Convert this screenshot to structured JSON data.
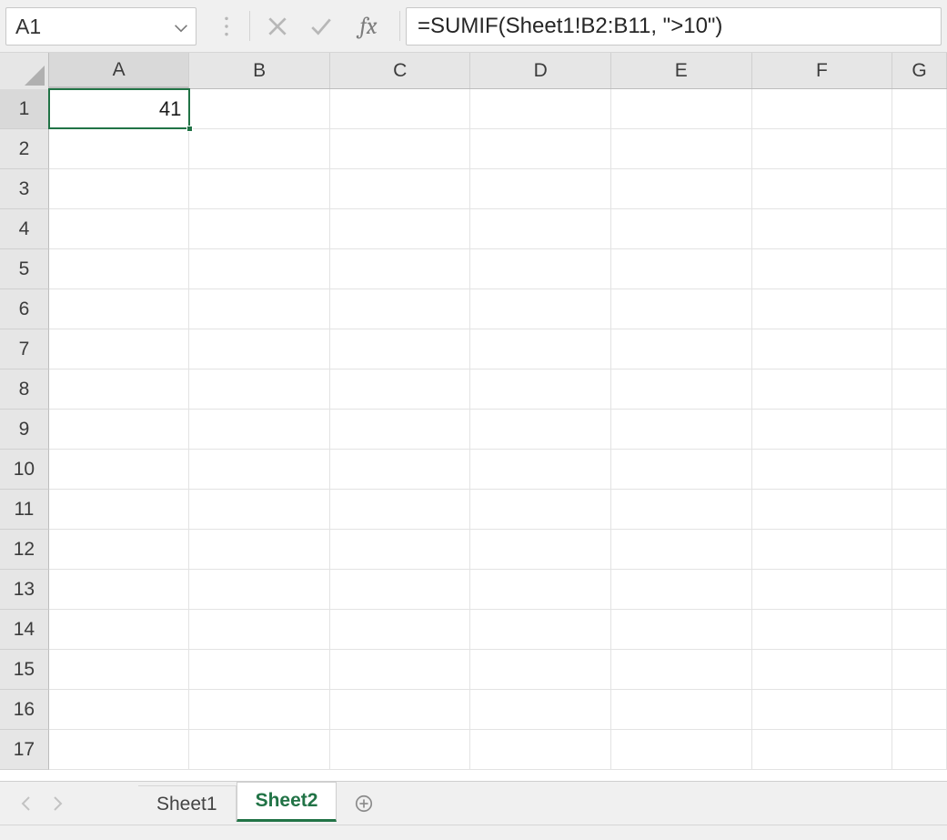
{
  "formula_bar": {
    "name_box_value": "A1",
    "formula": "=SUMIF(Sheet1!B2:B11, \">10\")"
  },
  "grid": {
    "columns": [
      "A",
      "B",
      "C",
      "D",
      "E",
      "F"
    ],
    "partial_column": "G",
    "row_count": 17,
    "selected_cell": {
      "row": 1,
      "col": "A",
      "value": "41"
    },
    "cell_values": {
      "A1": "41"
    }
  },
  "tabs": {
    "sheets": [
      {
        "name": "Sheet1",
        "active": false
      },
      {
        "name": "Sheet2",
        "active": true
      }
    ]
  }
}
